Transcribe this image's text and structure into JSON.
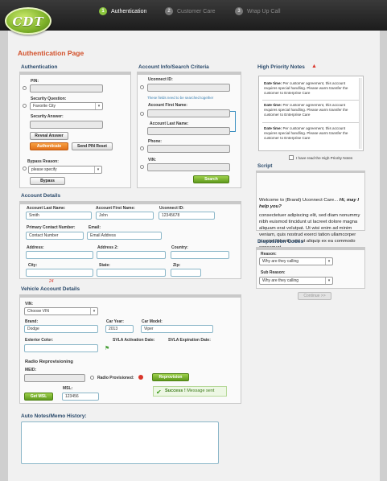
{
  "header": {
    "logo_text": "CDT",
    "steps": [
      {
        "num": "1",
        "label": "Authentication",
        "active": true
      },
      {
        "num": "2",
        "label": "Customer Care",
        "active": false
      },
      {
        "num": "3",
        "label": "Wrap Up Call",
        "active": false
      }
    ]
  },
  "page_title": "Authentication Page",
  "authentication": {
    "title": "Authentication",
    "pin_label": "PIN:",
    "pin_value": "",
    "security_question_label": "Security Question:",
    "security_question_value": "Favorite City",
    "security_answer_label": "Security Answer:",
    "security_answer_value": "",
    "reveal_answer": "Reveal Answer",
    "authenticate": "Authenticate",
    "send_pin_reset": "Send PIN Reset",
    "bypass_reason_label": "Bypass Reason:",
    "bypass_reason_value": "please specify",
    "bypass": "Bypass"
  },
  "account_search": {
    "title": "Account Info/Search Criteria",
    "uconnect_id_label": "Uconnect ID:",
    "hint": "These fields need to be searched together",
    "first_name_label": "Account First Name:",
    "last_name_label": "Account Last Name:",
    "phone_label": "Phone:",
    "vin_label": "VIN:",
    "search": "Search"
  },
  "high_priority": {
    "title": "High Priority Notes",
    "notes": [
      {
        "label": "Date time:",
        "text": " Per customer agreement, this account requires special handling.  Please warm transfer the customer to Enterprise Care"
      },
      {
        "label": "Date time:",
        "text": " Per customer agreement, this account requires special handling.  Please warm transfer the customer to Enterprise Care"
      },
      {
        "label": "Date time:",
        "text": " Per customer agreement, this account requires special handling.  Please warm transfer the customer to Enterprise Care"
      }
    ],
    "read_label": "I have read the High Priority Notes"
  },
  "script": {
    "title": "Script",
    "greeting": "Welcome to (Brand) Uconnect Care...",
    "greeting_bold": " Hi, may I help you?",
    "body": "consectetuer adipiscing elit, sed diam nonummy nibh euismod tincidunt ut lacreet dolore magna aliquam erat volutpat. Ut wisi enim ad minim veniam, quis nostrud exerci tation ullamcorper suscipit lobortis nisl ut aliquip ex ea commodo consequat."
  },
  "disposition": {
    "title": "Disposition Codes",
    "reason_label": "Reason:",
    "reason_value": "Why are they calling",
    "sub_reason_label": "Sub Reason:",
    "sub_reason_value": "Why are they calling",
    "continue": "Continue >>"
  },
  "account_details": {
    "title": "Account Details",
    "last_name_label": "Account Last Name:",
    "last_name_value": "Smith",
    "first_name_label": "Account First Name:",
    "first_name_value": "John",
    "uconnect_id_label": "Uconnect ID:",
    "uconnect_id_value": "12345678",
    "primary_contact_label": "Primary Contact Number:",
    "primary_contact_value": "Contact Number",
    "email_label": "Email:",
    "email_value": "Email Address",
    "address_label": "Address:",
    "address2_label": "Address 2:",
    "country_label": "Country:",
    "city_label": "City:",
    "state_label": "State:",
    "zip_label": "Zip:"
  },
  "vehicle": {
    "title": "Vehicle Account Details",
    "vin_label": "VIN:",
    "vin_value": "Choose VIN",
    "brand_label": "Brand:",
    "brand_value": "Dodge",
    "car_year_label": "Car Year:",
    "car_year_value": "2013",
    "car_model_label": "Car Model:",
    "car_model_value": "Viper",
    "exterior_color_label": "Exterior Color:",
    "svla_activation_label": "SVLA Activation Date:",
    "svla_expiration_label": "SVLA Expiration Date:",
    "radio_title": "Radio Reprovisioning",
    "meid_label": "MEID:",
    "radio_provisioned_label": "Radio Provisioned:",
    "reprovision": "Reprovision",
    "get_msl": "Get MSL",
    "msl_label": "MSL:",
    "msl_value": "123456",
    "success_bold": "Success !",
    "success_text": " Message sent",
    "marker": "24"
  },
  "notes": {
    "title": "Auto Notes/Memo History:"
  }
}
